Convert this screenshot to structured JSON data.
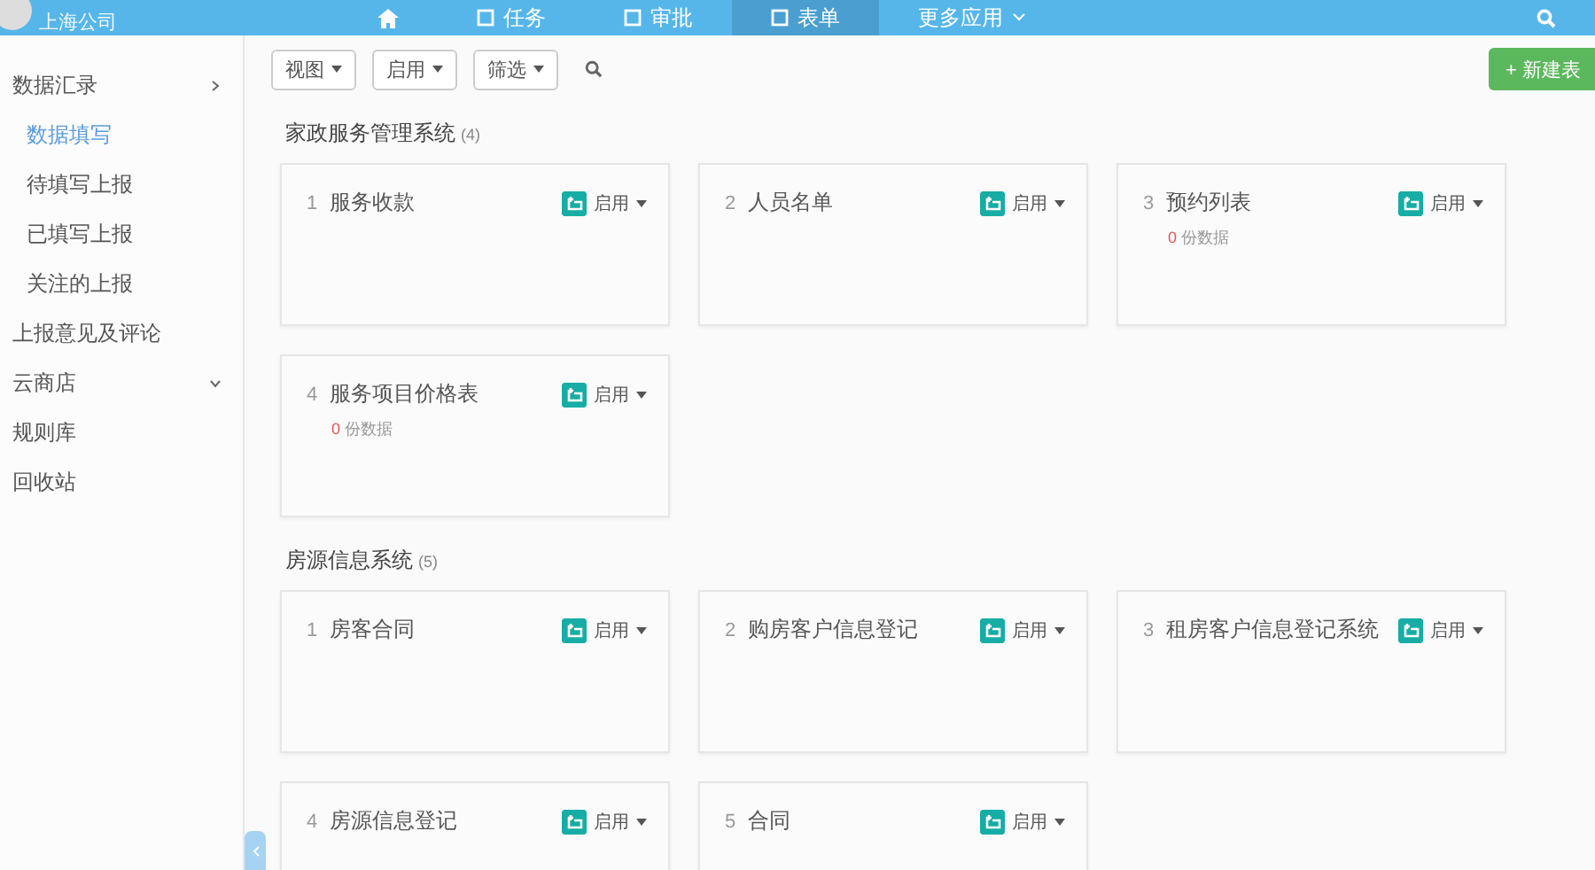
{
  "top_bar": {
    "company": "上海公司",
    "nav": [
      {
        "kind": "home",
        "selected": false
      },
      {
        "kind": "text",
        "label": "任务",
        "selected": false
      },
      {
        "kind": "text",
        "label": "审批",
        "selected": false
      },
      {
        "kind": "text",
        "label": "表单",
        "selected": true
      },
      {
        "kind": "menu",
        "label": "更多应用",
        "selected": false
      }
    ]
  },
  "sidebar": {
    "items": [
      {
        "label": "数据汇录",
        "expanded": true,
        "selected": false,
        "children": [
          {
            "label": "数据填写",
            "selected": true
          },
          {
            "label": "待填写上报",
            "selected": false
          },
          {
            "label": "已填写上报",
            "selected": false
          },
          {
            "label": "关注的上报",
            "selected": false
          }
        ]
      },
      {
        "label": "上报意见及评论",
        "selected": false
      },
      {
        "label": "云商店",
        "expanded": false,
        "selected": false
      },
      {
        "label": "规则库",
        "selected": false
      },
      {
        "label": "回收站",
        "selected": false
      }
    ]
  },
  "toolbar": {
    "filters": [
      "视图",
      "启用",
      "筛选"
    ],
    "new_button": "+ 新建表"
  },
  "groups": [
    {
      "title": "家政服务管理系统",
      "count": "(4)",
      "forms": [
        {
          "index": "1",
          "name": "服务收款",
          "status": "启用"
        },
        {
          "index": "2",
          "name": "人员名单",
          "status": "启用"
        },
        {
          "index": "3",
          "name": "预约列表",
          "status": "启用",
          "records": "0",
          "records_label": "份数据"
        },
        {
          "index": "4",
          "name": "服务项目价格表",
          "status": "启用",
          "records": "0",
          "records_label": "份数据"
        }
      ]
    },
    {
      "title": "房源信息系统",
      "count": "(5)",
      "forms": [
        {
          "index": "1",
          "name": "房客合同",
          "status": "启用"
        },
        {
          "index": "2",
          "name": "购房客户信息登记",
          "status": "启用"
        },
        {
          "index": "3",
          "name": "租房客户信息登记系统",
          "status": "启用"
        },
        {
          "index": "4",
          "name": "房源信息登记",
          "status": "启用"
        },
        {
          "index": "5",
          "name": "合同",
          "status": "启用"
        }
      ]
    }
  ]
}
